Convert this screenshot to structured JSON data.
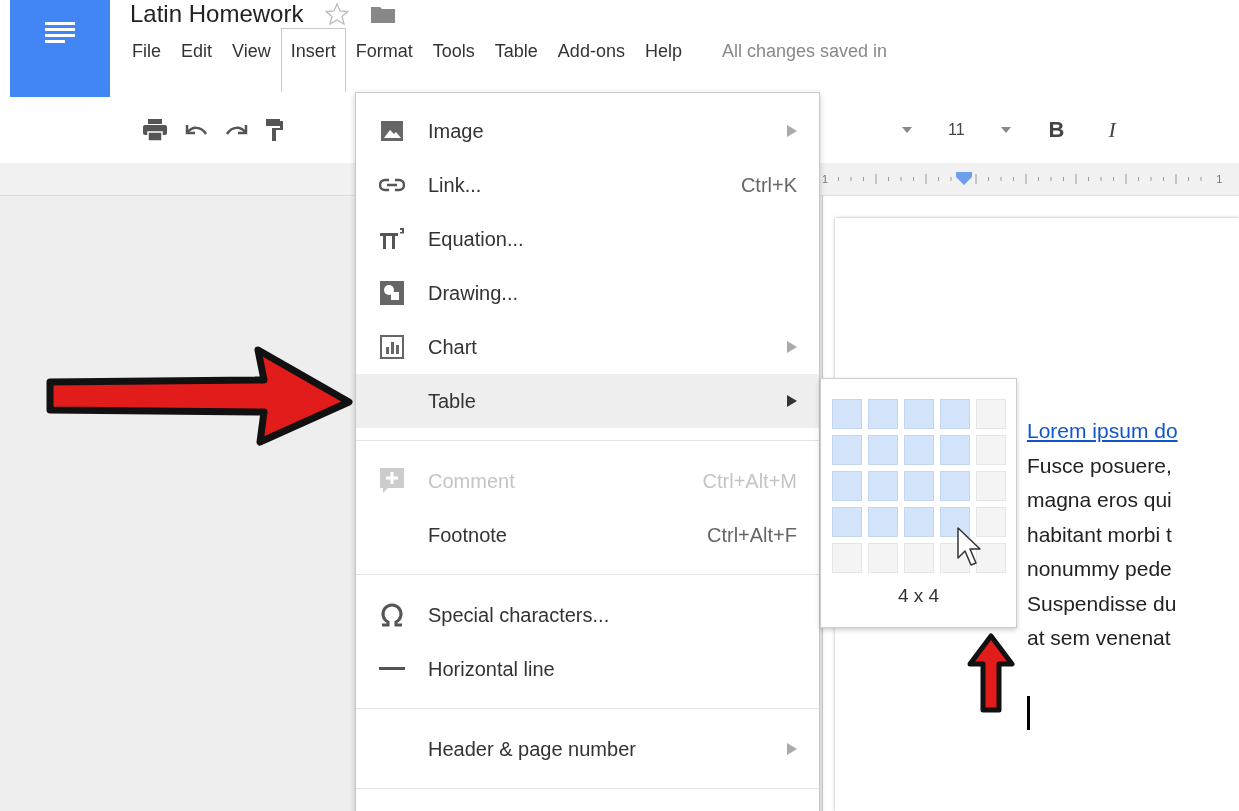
{
  "app": {
    "title": "Latin Homework",
    "starred": false
  },
  "menubar": [
    {
      "label": "File",
      "selected": false
    },
    {
      "label": "Edit",
      "selected": false
    },
    {
      "label": "View",
      "selected": false
    },
    {
      "label": "Insert",
      "selected": true
    },
    {
      "label": "Format",
      "selected": false
    },
    {
      "label": "Tools",
      "selected": false
    },
    {
      "label": "Table",
      "selected": false
    },
    {
      "label": "Add-ons",
      "selected": false
    },
    {
      "label": "Help",
      "selected": false
    }
  ],
  "save_status": "All changes saved in",
  "toolbar": {
    "font_size": "11",
    "bold": "B",
    "italic": "I"
  },
  "ruler": {
    "labels": [
      "1",
      "1"
    ]
  },
  "insert_menu": [
    {
      "kind": "item",
      "label": "Image",
      "submenu": true,
      "selected": false,
      "disabled": false
    },
    {
      "kind": "item",
      "label": "Link...",
      "shortcut": "Ctrl+K",
      "submenu": false,
      "selected": false,
      "disabled": false
    },
    {
      "kind": "item",
      "label": "Equation...",
      "submenu": false,
      "selected": false,
      "disabled": false
    },
    {
      "kind": "item",
      "label": "Drawing...",
      "submenu": false,
      "selected": false,
      "disabled": false
    },
    {
      "kind": "item",
      "label": "Chart",
      "submenu": true,
      "selected": false,
      "disabled": false
    },
    {
      "kind": "item",
      "label": "Table",
      "submenu": true,
      "selected": true,
      "disabled": false
    },
    {
      "kind": "separator"
    },
    {
      "kind": "item",
      "label": "Comment",
      "shortcut": "Ctrl+Alt+M",
      "submenu": false,
      "selected": false,
      "disabled": true
    },
    {
      "kind": "item",
      "label": "Footnote",
      "shortcut": "Ctrl+Alt+F",
      "submenu": false,
      "selected": false,
      "disabled": false
    },
    {
      "kind": "separator"
    },
    {
      "kind": "item",
      "label": "Special characters...",
      "submenu": false,
      "selected": false,
      "disabled": false
    },
    {
      "kind": "item",
      "label": "Horizontal line",
      "submenu": false,
      "selected": false,
      "disabled": false
    },
    {
      "kind": "separator"
    },
    {
      "kind": "item",
      "label": "Header & page number",
      "submenu": true,
      "selected": false,
      "disabled": false
    },
    {
      "kind": "separator"
    }
  ],
  "table_picker": {
    "rows": [
      {
        "cells": [
          {
            "selected": true
          },
          {
            "selected": true
          },
          {
            "selected": true
          },
          {
            "selected": true
          },
          {
            "selected": false
          }
        ]
      },
      {
        "cells": [
          {
            "selected": true
          },
          {
            "selected": true
          },
          {
            "selected": true
          },
          {
            "selected": true
          },
          {
            "selected": false
          }
        ]
      },
      {
        "cells": [
          {
            "selected": true
          },
          {
            "selected": true
          },
          {
            "selected": true
          },
          {
            "selected": true
          },
          {
            "selected": false
          }
        ]
      },
      {
        "cells": [
          {
            "selected": true
          },
          {
            "selected": true
          },
          {
            "selected": true
          },
          {
            "selected": true
          },
          {
            "selected": false
          }
        ]
      },
      {
        "cells": [
          {
            "selected": false
          },
          {
            "selected": false
          },
          {
            "selected": false
          },
          {
            "selected": false
          },
          {
            "selected": false
          }
        ]
      }
    ],
    "size_label": "4 x 4"
  },
  "document": {
    "lines": [
      {
        "kind": "link",
        "text": "Lorem ipsum do"
      },
      {
        "kind": "text",
        "text": "Fusce posuere,"
      },
      {
        "kind": "text",
        "text": "magna eros qui"
      },
      {
        "kind": "text",
        "text": "habitant morbi t"
      },
      {
        "kind": "text",
        "text": "nonummy pede"
      },
      {
        "kind": "text",
        "text": "Suspendisse du"
      },
      {
        "kind": "text",
        "text": "at sem venenat"
      }
    ]
  }
}
